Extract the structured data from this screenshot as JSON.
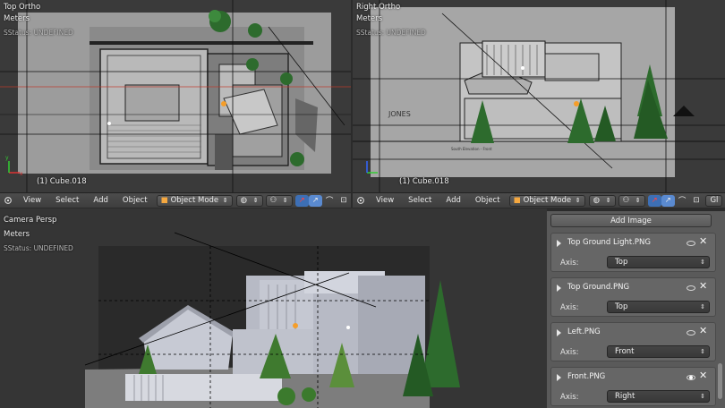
{
  "viewports": {
    "top": {
      "view_name": "Top Ortho",
      "units": "Meters",
      "status": "SStatus: UNDEFINED",
      "object": "(1) Cube.018"
    },
    "right": {
      "view_name": "Right Ortho",
      "units": "Meters",
      "status": "SStatus: UNDEFINED",
      "object": "(1) Cube.018"
    },
    "camera": {
      "view_name": "Camera Persp",
      "units": "Meters",
      "status": "SStatus: UNDEFINED"
    }
  },
  "header_left": {
    "view": "View",
    "select": "Select",
    "add": "Add",
    "object": "Object",
    "mode": "Object Mode"
  },
  "header_right": {
    "view": "View",
    "select": "Select",
    "add": "Add",
    "object": "Object",
    "mode": "Object Mode",
    "cut": "Gl"
  },
  "drawing_texts": {
    "jones": "JONES",
    "south_elevation": "South Elevation - Front"
  },
  "panel": {
    "add_image": "Add Image",
    "axis_label": "Axis:",
    "images": [
      {
        "name": "Top Ground Light.PNG",
        "axis": "Top",
        "visible": false
      },
      {
        "name": "Top Ground.PNG",
        "axis": "Top",
        "visible": false
      },
      {
        "name": "Left.PNG",
        "axis": "Front",
        "visible": false
      },
      {
        "name": "Front.PNG",
        "axis": "Right",
        "visible": true
      }
    ]
  },
  "colors": {
    "accent": "#f59e2a",
    "grid_green": "#4caf50",
    "grid_red": "#c0392b",
    "tree": "#2d6b2d"
  }
}
